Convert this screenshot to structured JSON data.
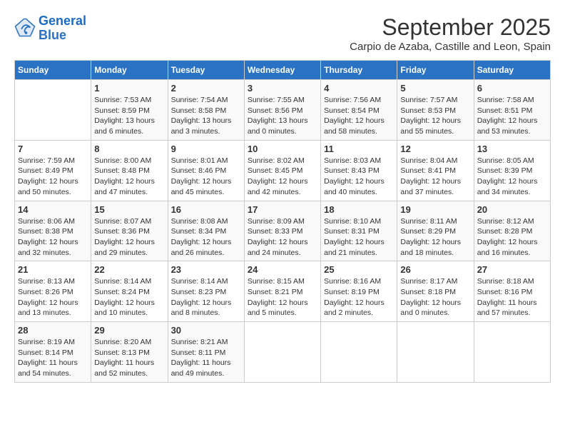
{
  "logo": {
    "line1": "General",
    "line2": "Blue"
  },
  "title": "September 2025",
  "subtitle": "Carpio de Azaba, Castille and Leon, Spain",
  "weekdays": [
    "Sunday",
    "Monday",
    "Tuesday",
    "Wednesday",
    "Thursday",
    "Friday",
    "Saturday"
  ],
  "weeks": [
    [
      {
        "day": "",
        "content": ""
      },
      {
        "day": "1",
        "content": "Sunrise: 7:53 AM\nSunset: 8:59 PM\nDaylight: 13 hours\nand 6 minutes."
      },
      {
        "day": "2",
        "content": "Sunrise: 7:54 AM\nSunset: 8:58 PM\nDaylight: 13 hours\nand 3 minutes."
      },
      {
        "day": "3",
        "content": "Sunrise: 7:55 AM\nSunset: 8:56 PM\nDaylight: 13 hours\nand 0 minutes."
      },
      {
        "day": "4",
        "content": "Sunrise: 7:56 AM\nSunset: 8:54 PM\nDaylight: 12 hours\nand 58 minutes."
      },
      {
        "day": "5",
        "content": "Sunrise: 7:57 AM\nSunset: 8:53 PM\nDaylight: 12 hours\nand 55 minutes."
      },
      {
        "day": "6",
        "content": "Sunrise: 7:58 AM\nSunset: 8:51 PM\nDaylight: 12 hours\nand 53 minutes."
      }
    ],
    [
      {
        "day": "7",
        "content": "Sunrise: 7:59 AM\nSunset: 8:49 PM\nDaylight: 12 hours\nand 50 minutes."
      },
      {
        "day": "8",
        "content": "Sunrise: 8:00 AM\nSunset: 8:48 PM\nDaylight: 12 hours\nand 47 minutes."
      },
      {
        "day": "9",
        "content": "Sunrise: 8:01 AM\nSunset: 8:46 PM\nDaylight: 12 hours\nand 45 minutes."
      },
      {
        "day": "10",
        "content": "Sunrise: 8:02 AM\nSunset: 8:45 PM\nDaylight: 12 hours\nand 42 minutes."
      },
      {
        "day": "11",
        "content": "Sunrise: 8:03 AM\nSunset: 8:43 PM\nDaylight: 12 hours\nand 40 minutes."
      },
      {
        "day": "12",
        "content": "Sunrise: 8:04 AM\nSunset: 8:41 PM\nDaylight: 12 hours\nand 37 minutes."
      },
      {
        "day": "13",
        "content": "Sunrise: 8:05 AM\nSunset: 8:39 PM\nDaylight: 12 hours\nand 34 minutes."
      }
    ],
    [
      {
        "day": "14",
        "content": "Sunrise: 8:06 AM\nSunset: 8:38 PM\nDaylight: 12 hours\nand 32 minutes."
      },
      {
        "day": "15",
        "content": "Sunrise: 8:07 AM\nSunset: 8:36 PM\nDaylight: 12 hours\nand 29 minutes."
      },
      {
        "day": "16",
        "content": "Sunrise: 8:08 AM\nSunset: 8:34 PM\nDaylight: 12 hours\nand 26 minutes."
      },
      {
        "day": "17",
        "content": "Sunrise: 8:09 AM\nSunset: 8:33 PM\nDaylight: 12 hours\nand 24 minutes."
      },
      {
        "day": "18",
        "content": "Sunrise: 8:10 AM\nSunset: 8:31 PM\nDaylight: 12 hours\nand 21 minutes."
      },
      {
        "day": "19",
        "content": "Sunrise: 8:11 AM\nSunset: 8:29 PM\nDaylight: 12 hours\nand 18 minutes."
      },
      {
        "day": "20",
        "content": "Sunrise: 8:12 AM\nSunset: 8:28 PM\nDaylight: 12 hours\nand 16 minutes."
      }
    ],
    [
      {
        "day": "21",
        "content": "Sunrise: 8:13 AM\nSunset: 8:26 PM\nDaylight: 12 hours\nand 13 minutes."
      },
      {
        "day": "22",
        "content": "Sunrise: 8:14 AM\nSunset: 8:24 PM\nDaylight: 12 hours\nand 10 minutes."
      },
      {
        "day": "23",
        "content": "Sunrise: 8:14 AM\nSunset: 8:23 PM\nDaylight: 12 hours\nand 8 minutes."
      },
      {
        "day": "24",
        "content": "Sunrise: 8:15 AM\nSunset: 8:21 PM\nDaylight: 12 hours\nand 5 minutes."
      },
      {
        "day": "25",
        "content": "Sunrise: 8:16 AM\nSunset: 8:19 PM\nDaylight: 12 hours\nand 2 minutes."
      },
      {
        "day": "26",
        "content": "Sunrise: 8:17 AM\nSunset: 8:18 PM\nDaylight: 12 hours\nand 0 minutes."
      },
      {
        "day": "27",
        "content": "Sunrise: 8:18 AM\nSunset: 8:16 PM\nDaylight: 11 hours\nand 57 minutes."
      }
    ],
    [
      {
        "day": "28",
        "content": "Sunrise: 8:19 AM\nSunset: 8:14 PM\nDaylight: 11 hours\nand 54 minutes."
      },
      {
        "day": "29",
        "content": "Sunrise: 8:20 AM\nSunset: 8:13 PM\nDaylight: 11 hours\nand 52 minutes."
      },
      {
        "day": "30",
        "content": "Sunrise: 8:21 AM\nSunset: 8:11 PM\nDaylight: 11 hours\nand 49 minutes."
      },
      {
        "day": "",
        "content": ""
      },
      {
        "day": "",
        "content": ""
      },
      {
        "day": "",
        "content": ""
      },
      {
        "day": "",
        "content": ""
      }
    ]
  ]
}
